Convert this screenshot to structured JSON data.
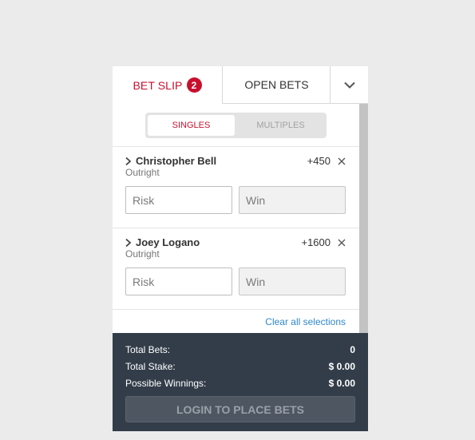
{
  "colors": {
    "accent": "#c8102e",
    "footer_bg": "#333d4a",
    "link": "#2f87c9",
    "page_bg": "#ebebeb"
  },
  "tabs": {
    "bet_slip": "BET SLIP",
    "bet_slip_count": "2",
    "open_bets": "OPEN BETS",
    "toggle_icon": "chevron-down-icon"
  },
  "mode": {
    "singles": "SINGLES",
    "multiples": "MULTIPLES",
    "selected": "SINGLES"
  },
  "bets": [
    {
      "selection": "Christopher Bell",
      "market": "Outright",
      "odds": "+450",
      "risk_placeholder": "Risk",
      "risk_value": "",
      "win_placeholder": "Win",
      "win_value": ""
    },
    {
      "selection": "Joey Logano",
      "market": "Outright",
      "odds": "+1600",
      "risk_placeholder": "Risk",
      "risk_value": "",
      "win_placeholder": "Win",
      "win_value": ""
    }
  ],
  "clear_all": "Clear all selections",
  "summary": {
    "total_bets_label": "Total Bets:",
    "total_bets_value": "0",
    "total_stake_label": "Total Stake:",
    "total_stake_value": "$ 0.00",
    "possible_winnings_label": "Possible Winnings:",
    "possible_winnings_value": "$ 0.00"
  },
  "login_button": "LOGIN TO PLACE BETS"
}
